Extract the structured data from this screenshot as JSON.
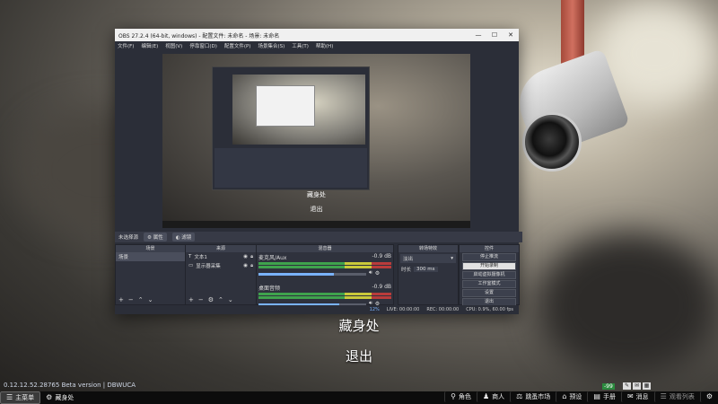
{
  "obs": {
    "title": "OBS 27.2.4 (64-bit, windows) - 配置文件: 未命名 - 场景: 未命名",
    "window_controls": [
      "—",
      "☐",
      "✕"
    ],
    "menu": [
      "文件(F)",
      "编辑(E)",
      "视图(V)",
      "停靠窗口(D)",
      "配置文件(P)",
      "场景集合(S)",
      "工具(T)",
      "帮助(H)"
    ],
    "preview": {
      "text1": "藏身处",
      "text2": "退出"
    },
    "toolbar": {
      "no_source": "未选择源",
      "properties": "属性",
      "filters": "滤镜"
    },
    "scenes": {
      "header": "场景",
      "items": [
        "场景"
      ]
    },
    "sources": {
      "header": "来源",
      "items": [
        "文本1",
        "显示器采集"
      ]
    },
    "mixer": {
      "header": "混音器",
      "tracks": [
        {
          "name": "麦克风/Aux",
          "db": "-0.9 dB",
          "level": 0.7
        },
        {
          "name": "桌面音频",
          "db": "-0.9 dB",
          "level": 0.75
        }
      ]
    },
    "transitions": {
      "header": "转场特效",
      "type": "淡出",
      "duration_label": "时长",
      "duration": "300 ms"
    },
    "controls": {
      "header": "控件",
      "buttons": [
        "停止推流",
        "开始录制",
        "启动虚拟摄像机",
        "工作室模式",
        "设置",
        "退出"
      ]
    },
    "status": {
      "live": "LIVE: 00:00:00",
      "rec": "REC: 00:00:00",
      "cpu": "CPU: 0.9%, 60.00 fps",
      "dropped": "12%"
    }
  },
  "overlay": {
    "text1": "藏身处",
    "text2": "退出"
  },
  "version_text": "0.12.12.52.28765 Beta version | DBWUCA",
  "fps_badge": "-99",
  "taskbar": {
    "left": [
      {
        "icon": "menu-icon",
        "label": "主菜单"
      },
      {
        "icon": "gear-icon",
        "label": "藏身处"
      }
    ],
    "right": [
      {
        "icon": "character-icon",
        "label": "角色"
      },
      {
        "icon": "merchant-icon",
        "label": "商人"
      },
      {
        "icon": "flea-market-icon",
        "label": "跳蚤市场"
      },
      {
        "icon": "hideout-icon",
        "label": "预设"
      },
      {
        "icon": "handbook-icon",
        "label": "手册"
      },
      {
        "icon": "messenger-icon",
        "label": "消息"
      },
      {
        "icon": "notes-icon",
        "label": "观看列表"
      }
    ]
  }
}
